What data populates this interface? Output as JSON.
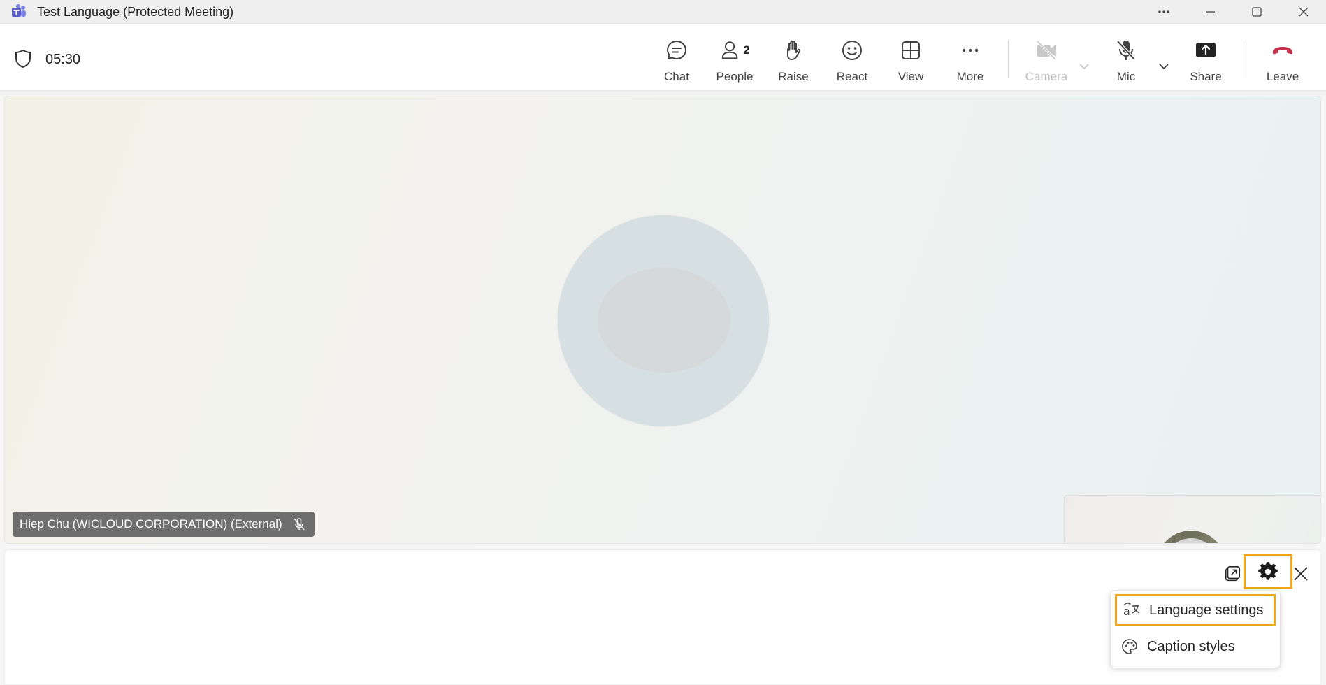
{
  "window": {
    "title": "Test Language (Protected Meeting)",
    "accent_color": "#5b5fc7"
  },
  "toolbar": {
    "timer": "05:30",
    "people_count": "2",
    "buttons": {
      "chat": "Chat",
      "people": "People",
      "raise": "Raise",
      "react": "React",
      "view": "View",
      "more": "More",
      "camera": "Camera",
      "mic": "Mic",
      "share": "Share",
      "leave": "Leave"
    },
    "leave_color": "#c4314b"
  },
  "stage": {
    "participant_name": "Hiep Chu (WICLOUD CORPORATION) (External)"
  },
  "captions": {
    "highlight_color": "#f2a516",
    "menu": {
      "items": [
        {
          "label": "Language settings",
          "icon": "translate-icon"
        },
        {
          "label": "Caption styles",
          "icon": "palette-icon"
        }
      ]
    }
  }
}
